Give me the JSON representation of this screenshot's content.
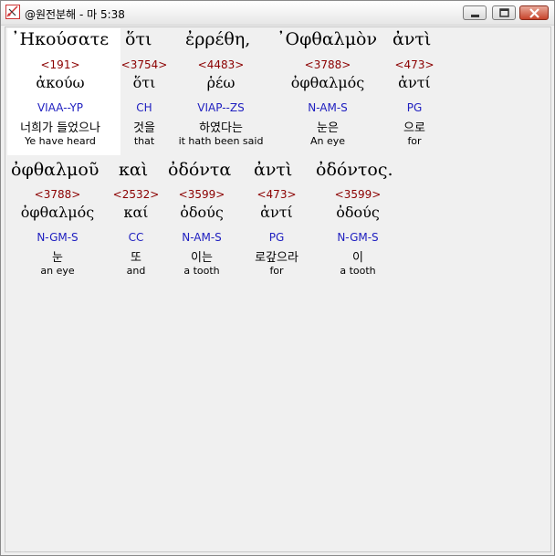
{
  "window": {
    "title": "@원전분해 - 마 5:38"
  },
  "row1": {
    "greek": [
      "᾿Ηκούσατε",
      "ὅτι",
      "ἐρρέθη,",
      "᾿Οφθαλμὸν",
      "ἀντὶ"
    ],
    "words": [
      {
        "strong": "<191>",
        "lemma": "ἀκούω",
        "morph": "VIAA--YP",
        "korean": "너희가 들었으나",
        "english": "Ye have heard"
      },
      {
        "strong": "<3754>",
        "lemma": "ὅτι",
        "morph": "CH",
        "korean": "것을",
        "english": "that"
      },
      {
        "strong": "<4483>",
        "lemma": "ῥέω",
        "morph": "VIAP--ZS",
        "korean": "하였다는",
        "english": "it hath been said"
      },
      {
        "strong": "<3788>",
        "lemma": "ὀφθαλμός",
        "morph": "N-AM-S",
        "korean": "눈은",
        "english": "An eye"
      },
      {
        "strong": "<473>",
        "lemma": "ἀντί",
        "morph": "PG",
        "korean": "으로",
        "english": "for"
      }
    ]
  },
  "row2": {
    "greek": [
      "ὀφθαλμοῦ",
      "καὶ",
      "ὀδόντα",
      "ἀντὶ",
      "ὀδόντος."
    ],
    "words": [
      {
        "strong": "<3788>",
        "lemma": "ὀφθαλμός",
        "morph": "N-GM-S",
        "korean": "눈",
        "english": "an eye"
      },
      {
        "strong": "<2532>",
        "lemma": "καί",
        "morph": "CC",
        "korean": "또",
        "english": "and"
      },
      {
        "strong": "<3599>",
        "lemma": "ὀδούς",
        "morph": "N-AM-S",
        "korean": "이는",
        "english": "a tooth"
      },
      {
        "strong": "<473>",
        "lemma": "ἀντί",
        "morph": "PG",
        "korean": "로갚으라",
        "english": "for"
      },
      {
        "strong": "<3599>",
        "lemma": "ὀδούς",
        "morph": "N-GM-S",
        "korean": "이",
        "english": "a tooth"
      }
    ]
  }
}
